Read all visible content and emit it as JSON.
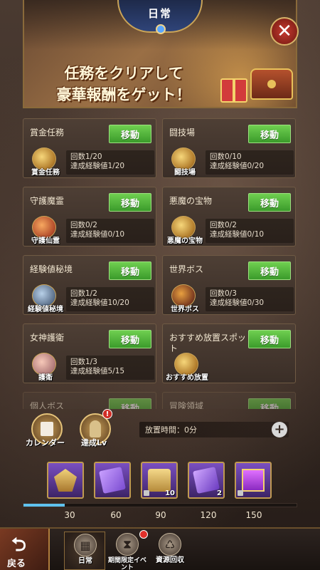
{
  "header": {
    "title": "日常",
    "banner_line1": "任務をクリアして",
    "banner_line2": "豪華報酬をゲット！",
    "close_symbol": "✕"
  },
  "tasks": [
    {
      "title": "賞金任務",
      "button": "移動",
      "icon_label": "賞金任務",
      "count": "回数1/20",
      "exp": "達成経験値1/20",
      "icon": "gold-coins-icon"
    },
    {
      "title": "闘技場",
      "button": "移動",
      "icon_label": "闘技場",
      "count": "回数0/10",
      "exp": "達成経験値0/20",
      "icon": "arena-icon"
    },
    {
      "title": "守護魔霊",
      "button": "移動",
      "icon_label": "守護仙霊",
      "count": "回数0/2",
      "exp": "達成経験値0/10",
      "icon": "guardian-spirit-icon"
    },
    {
      "title": "悪魔の宝物",
      "button": "移動",
      "icon_label": "悪魔の宝物",
      "count": "回数0/2",
      "exp": "達成経験値0/10",
      "icon": "treasure-icon"
    },
    {
      "title": "経験値秘境",
      "button": "移動",
      "icon_label": "経験値秘境",
      "count": "回数1/2",
      "exp": "達成経験値10/20",
      "icon": "exp-realm-icon"
    },
    {
      "title": "世界ボス",
      "button": "移動",
      "icon_label": "世界ボス",
      "count": "回数0/3",
      "exp": "達成経験値0/30",
      "icon": "world-boss-icon"
    },
    {
      "title": "女神護衛",
      "button": "移動",
      "icon_label": "護衛",
      "count": "回数1/3",
      "exp": "達成経験値5/15",
      "icon": "goddess-icon"
    },
    {
      "title": "おすすめ放置スポット",
      "button": "移動",
      "icon_label": "おすすめ放置",
      "count": "",
      "exp": "",
      "icon": "idle-spot-icon"
    },
    {
      "title": "個人ボス",
      "button": "移動"
    },
    {
      "title": "冒険領域",
      "button": "移動"
    }
  ],
  "actions": {
    "calendar_label": "カレンダー",
    "achievement_label": "達成Lv",
    "achievement_badge": "!",
    "idle_time": "放置時間：0分",
    "plus_symbol": "+"
  },
  "rewards": [
    {
      "icon": "wing-emblem-icon",
      "count": ""
    },
    {
      "icon": "purple-ticket-icon",
      "count": ""
    },
    {
      "icon": "scroll-chest-icon",
      "count": "10"
    },
    {
      "icon": "purple-card-icon",
      "count": "2"
    },
    {
      "icon": "gift-box-icon",
      "count": ""
    }
  ],
  "progress": {
    "value": 0.15,
    "ticks": [
      "30",
      "60",
      "90",
      "120",
      "150"
    ]
  },
  "nav": {
    "back_label": "戻る",
    "back_symbol": "⮌",
    "tabs": [
      {
        "label": "日常",
        "icon": "calendar-icon"
      },
      {
        "label": "期間限定イベント",
        "icon": "hourglass-icon"
      },
      {
        "label": "資源回収",
        "icon": "recycle-icon"
      }
    ]
  },
  "colors": {
    "move_button": "#4cae36",
    "progress_fill": "#5fc2ee",
    "badge": "#d12d26"
  }
}
